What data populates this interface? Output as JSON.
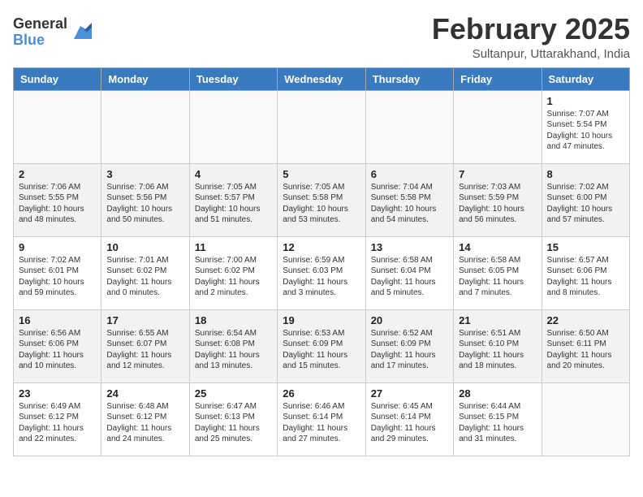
{
  "logo": {
    "general": "General",
    "blue": "Blue"
  },
  "title": "February 2025",
  "location": "Sultanpur, Uttarakhand, India",
  "weekdays": [
    "Sunday",
    "Monday",
    "Tuesday",
    "Wednesday",
    "Thursday",
    "Friday",
    "Saturday"
  ],
  "weeks": [
    [
      {
        "day": "",
        "info": ""
      },
      {
        "day": "",
        "info": ""
      },
      {
        "day": "",
        "info": ""
      },
      {
        "day": "",
        "info": ""
      },
      {
        "day": "",
        "info": ""
      },
      {
        "day": "",
        "info": ""
      },
      {
        "day": "1",
        "info": "Sunrise: 7:07 AM\nSunset: 5:54 PM\nDaylight: 10 hours and 47 minutes."
      }
    ],
    [
      {
        "day": "2",
        "info": "Sunrise: 7:06 AM\nSunset: 5:55 PM\nDaylight: 10 hours and 48 minutes."
      },
      {
        "day": "3",
        "info": "Sunrise: 7:06 AM\nSunset: 5:56 PM\nDaylight: 10 hours and 50 minutes."
      },
      {
        "day": "4",
        "info": "Sunrise: 7:05 AM\nSunset: 5:57 PM\nDaylight: 10 hours and 51 minutes."
      },
      {
        "day": "5",
        "info": "Sunrise: 7:05 AM\nSunset: 5:58 PM\nDaylight: 10 hours and 53 minutes."
      },
      {
        "day": "6",
        "info": "Sunrise: 7:04 AM\nSunset: 5:58 PM\nDaylight: 10 hours and 54 minutes."
      },
      {
        "day": "7",
        "info": "Sunrise: 7:03 AM\nSunset: 5:59 PM\nDaylight: 10 hours and 56 minutes."
      },
      {
        "day": "8",
        "info": "Sunrise: 7:02 AM\nSunset: 6:00 PM\nDaylight: 10 hours and 57 minutes."
      }
    ],
    [
      {
        "day": "9",
        "info": "Sunrise: 7:02 AM\nSunset: 6:01 PM\nDaylight: 10 hours and 59 minutes."
      },
      {
        "day": "10",
        "info": "Sunrise: 7:01 AM\nSunset: 6:02 PM\nDaylight: 11 hours and 0 minutes."
      },
      {
        "day": "11",
        "info": "Sunrise: 7:00 AM\nSunset: 6:02 PM\nDaylight: 11 hours and 2 minutes."
      },
      {
        "day": "12",
        "info": "Sunrise: 6:59 AM\nSunset: 6:03 PM\nDaylight: 11 hours and 3 minutes."
      },
      {
        "day": "13",
        "info": "Sunrise: 6:58 AM\nSunset: 6:04 PM\nDaylight: 11 hours and 5 minutes."
      },
      {
        "day": "14",
        "info": "Sunrise: 6:58 AM\nSunset: 6:05 PM\nDaylight: 11 hours and 7 minutes."
      },
      {
        "day": "15",
        "info": "Sunrise: 6:57 AM\nSunset: 6:06 PM\nDaylight: 11 hours and 8 minutes."
      }
    ],
    [
      {
        "day": "16",
        "info": "Sunrise: 6:56 AM\nSunset: 6:06 PM\nDaylight: 11 hours and 10 minutes."
      },
      {
        "day": "17",
        "info": "Sunrise: 6:55 AM\nSunset: 6:07 PM\nDaylight: 11 hours and 12 minutes."
      },
      {
        "day": "18",
        "info": "Sunrise: 6:54 AM\nSunset: 6:08 PM\nDaylight: 11 hours and 13 minutes."
      },
      {
        "day": "19",
        "info": "Sunrise: 6:53 AM\nSunset: 6:09 PM\nDaylight: 11 hours and 15 minutes."
      },
      {
        "day": "20",
        "info": "Sunrise: 6:52 AM\nSunset: 6:09 PM\nDaylight: 11 hours and 17 minutes."
      },
      {
        "day": "21",
        "info": "Sunrise: 6:51 AM\nSunset: 6:10 PM\nDaylight: 11 hours and 18 minutes."
      },
      {
        "day": "22",
        "info": "Sunrise: 6:50 AM\nSunset: 6:11 PM\nDaylight: 11 hours and 20 minutes."
      }
    ],
    [
      {
        "day": "23",
        "info": "Sunrise: 6:49 AM\nSunset: 6:12 PM\nDaylight: 11 hours and 22 minutes."
      },
      {
        "day": "24",
        "info": "Sunrise: 6:48 AM\nSunset: 6:12 PM\nDaylight: 11 hours and 24 minutes."
      },
      {
        "day": "25",
        "info": "Sunrise: 6:47 AM\nSunset: 6:13 PM\nDaylight: 11 hours and 25 minutes."
      },
      {
        "day": "26",
        "info": "Sunrise: 6:46 AM\nSunset: 6:14 PM\nDaylight: 11 hours and 27 minutes."
      },
      {
        "day": "27",
        "info": "Sunrise: 6:45 AM\nSunset: 6:14 PM\nDaylight: 11 hours and 29 minutes."
      },
      {
        "day": "28",
        "info": "Sunrise: 6:44 AM\nSunset: 6:15 PM\nDaylight: 11 hours and 31 minutes."
      },
      {
        "day": "",
        "info": ""
      }
    ]
  ]
}
